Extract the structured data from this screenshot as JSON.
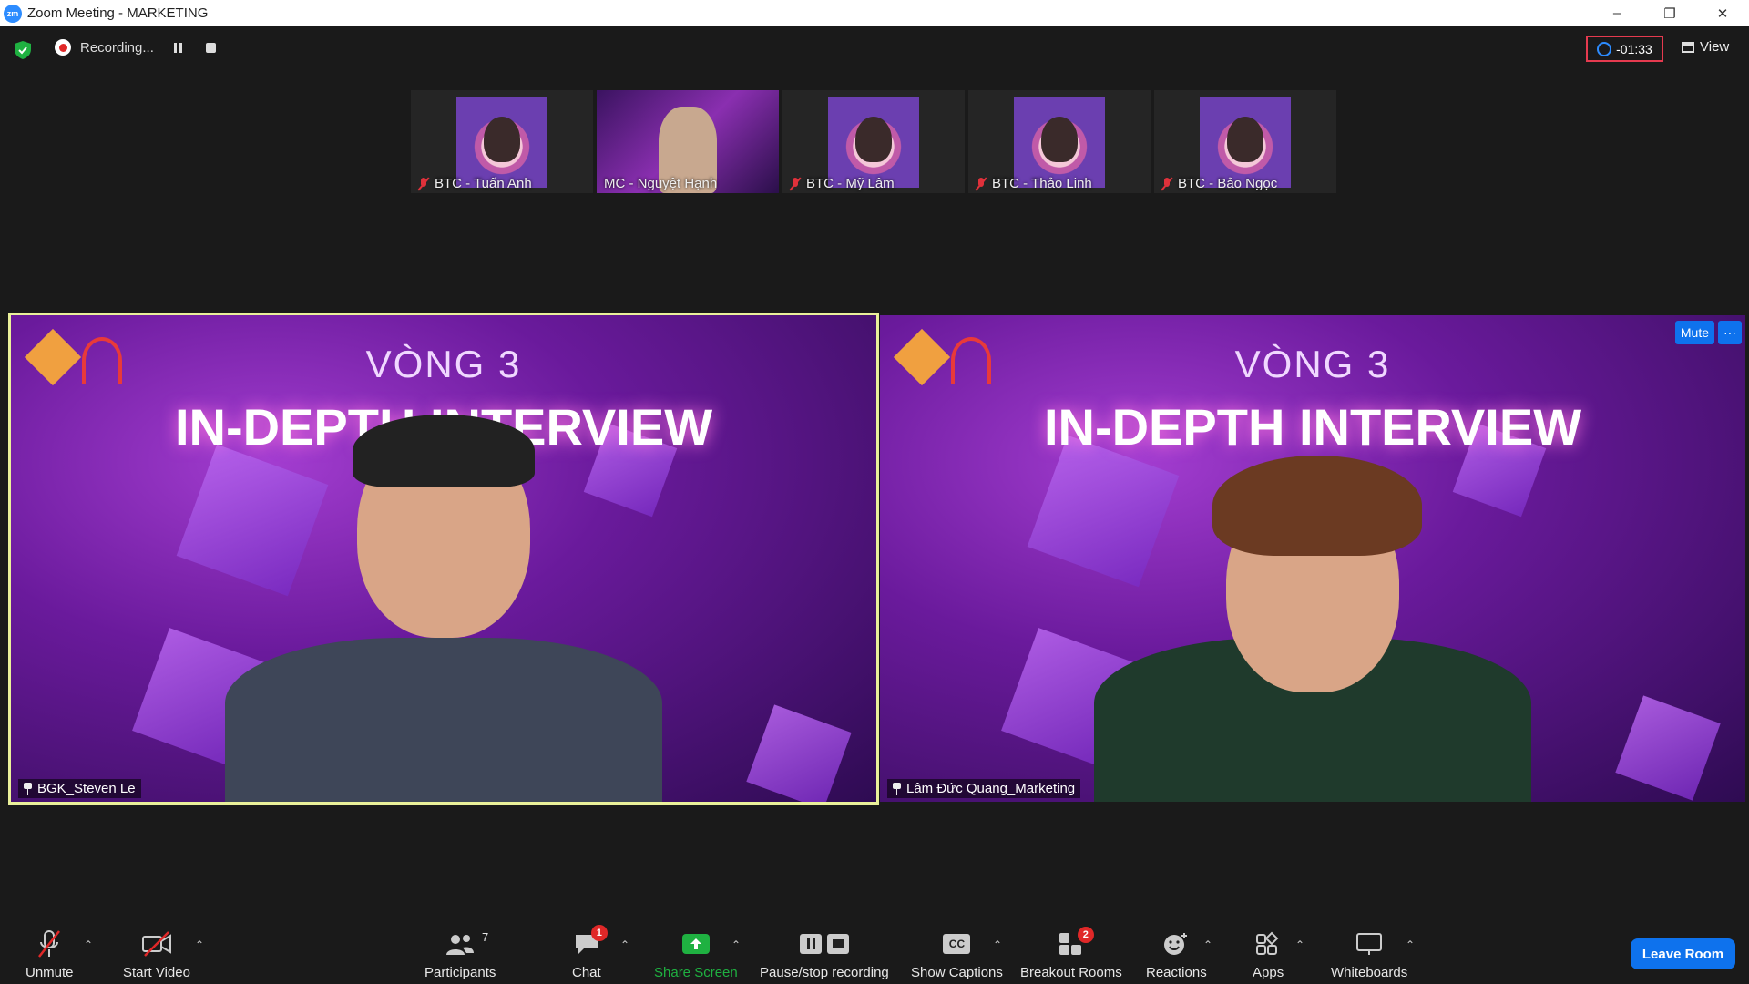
{
  "window": {
    "title": "Zoom Meeting - MARKETING",
    "minimize": "–",
    "restore": "❐",
    "close": "✕"
  },
  "topbar": {
    "recording_label": "Recording...",
    "timer": "-01:33",
    "view_label": "View",
    "colors": {
      "secure": "#1fb141",
      "timer_border": "#e53a4f",
      "accent": "#2d8cff"
    }
  },
  "thumbnails": [
    {
      "name": "BTC - Tuấn Anh",
      "muted": true,
      "video": false
    },
    {
      "name": "MC - Nguyệt Hạnh",
      "muted": false,
      "video": true
    },
    {
      "name": "BTC - Mỹ Lâm",
      "muted": true,
      "video": false
    },
    {
      "name": "BTC - Thảo Linh",
      "muted": true,
      "video": false
    },
    {
      "name": "BTC - Bảo Ngọc",
      "muted": true,
      "video": false
    }
  ],
  "main_tiles": [
    {
      "name": "BGK_Steven Le",
      "header_small": "VÒNG 3",
      "header_big": "IN-DEPTH INTERVIEW",
      "active_speaker": true
    },
    {
      "name": "Lâm Đức Quang_Marketing",
      "header_small": "VÒNG 3",
      "header_big": "IN-DEPTH INTERVIEW",
      "mute_label": "Mute",
      "more_label": "···"
    }
  ],
  "toolbar": {
    "unmute": "Unmute",
    "start_video": "Start Video",
    "participants": "Participants",
    "participants_count": "7",
    "chat": "Chat",
    "chat_badge": "1",
    "share_screen": "Share Screen",
    "pause_stop_recording": "Pause/stop recording",
    "show_captions": "Show Captions",
    "captions_icon_text": "CC",
    "breakout_rooms": "Breakout Rooms",
    "breakout_badge": "2",
    "reactions": "Reactions",
    "apps": "Apps",
    "whiteboards": "Whiteboards",
    "leave_room": "Leave Room",
    "share_color": "#1fb141"
  }
}
